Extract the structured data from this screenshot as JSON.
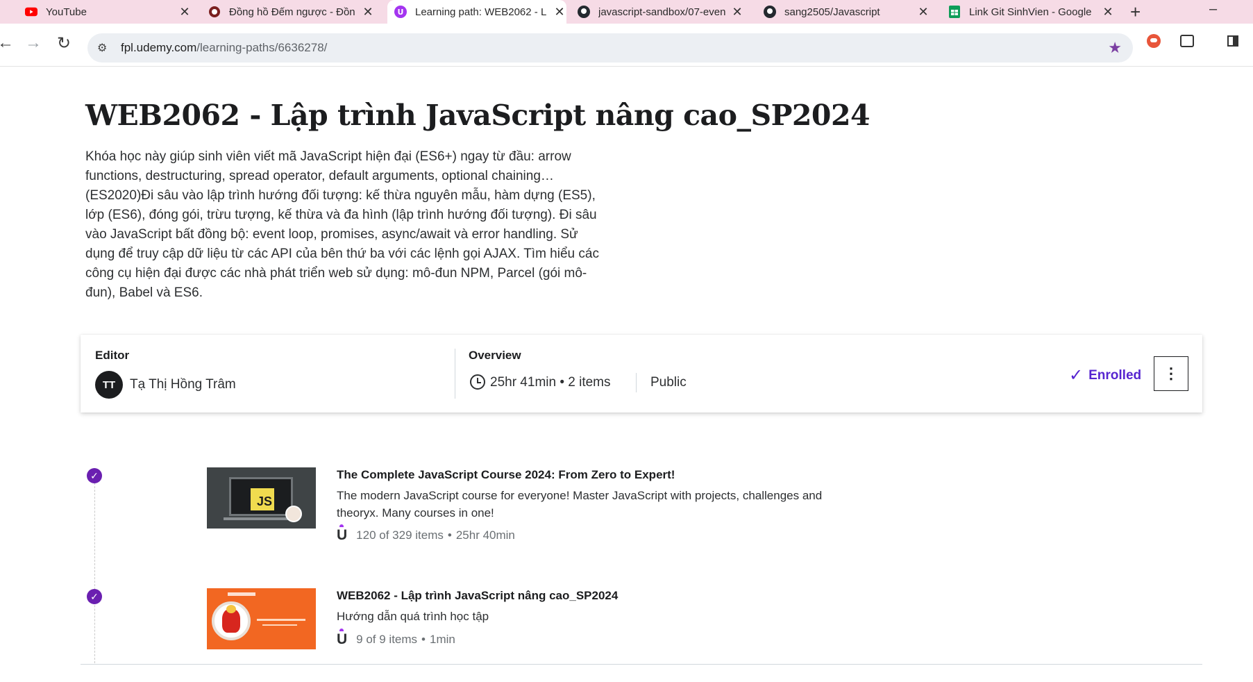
{
  "browser": {
    "tabs": [
      {
        "title": "YouTube",
        "icon": "youtube-icon",
        "color": "#ff0000"
      },
      {
        "title": "Đồng hồ Đếm ngược - Đồn",
        "icon": "timer-site-icon",
        "color": "#7a1f1f"
      },
      {
        "title": "Learning path: WEB2062 - L",
        "icon": "udemy-icon",
        "color": "#a435f0",
        "active": true
      },
      {
        "title": "javascript-sandbox/07-even",
        "icon": "github-icon",
        "color": "#24292f"
      },
      {
        "title": "sang2505/Javascript",
        "icon": "github-icon",
        "color": "#24292f"
      },
      {
        "title": "Link Git SinhVien - Google",
        "icon": "google-sheets-icon",
        "color": "#0f9d58"
      }
    ],
    "new_tab": "+",
    "minimize": "–",
    "url_host": "fpl.udemy.com",
    "url_path": "/learning-paths/6636278/"
  },
  "page": {
    "title": "WEB2062 - Lập trình JavaScript nâng cao_SP2024",
    "description": "Khóa học này giúp sinh viên viết mã JavaScript hiện đại (ES6+) ngay từ đầu: arrow functions, destructuring, spread operator, default arguments, optional chaining…(ES2020)Đi sâu vào lập trình hướng đối tượng: kế thừa nguyên mẫu, hàm dựng (ES5), lớp (ES6), đóng gói, trừu tượng, kế thừa và đa hình (lập trình hướng đối tượng). Đi sâu vào JavaScript bất đồng bộ: event loop, promises, async/await và error handling. Sử dụng để truy cập dữ liệu từ các API của bên thứ ba với các lệnh gọi AJAX. Tìm hiểu các công cụ hiện đại được các nhà phát triển web sử dụng: mô-đun NPM, Parcel (gói mô-đun), Babel và ES6."
  },
  "info": {
    "editor_label": "Editor",
    "editor_initials": "TT",
    "editor_name": "Tạ Thị Hồng Trâm",
    "overview_label": "Overview",
    "overview_value": "25hr 41min • 2 items",
    "visibility": "Public",
    "enrolled_label": "Enrolled",
    "more_button": "⋮"
  },
  "courses": [
    {
      "title": "The Complete JavaScript Course 2024: From Zero to Expert!",
      "description": "The modern JavaScript course for everyone! Master JavaScript with projects, challenges and theoryx. Many courses in one!",
      "progress": "120 of 329 items",
      "duration": "25hr 40min",
      "thumb_label": "JS"
    },
    {
      "title": "WEB2062 - Lập trình JavaScript nâng cao_SP2024",
      "description": "Hướng dẫn quá trình học tập",
      "progress": "9 of 9 items",
      "duration": "1min"
    }
  ],
  "colors": {
    "accent": "#5624d0",
    "check": "#6a1fb0",
    "tabbar": "#f6dbe6"
  }
}
